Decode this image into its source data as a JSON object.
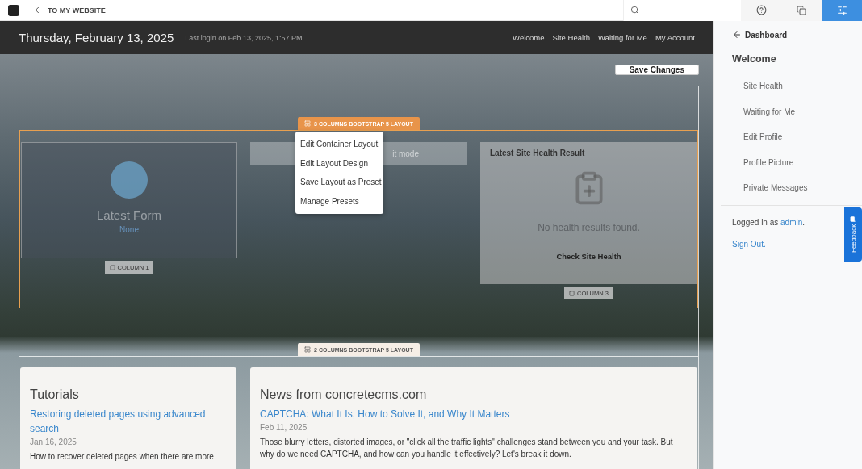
{
  "toolbar": {
    "back_link": "TO MY WEBSITE",
    "buttons": [
      {
        "kind": "help",
        "selected": false
      },
      {
        "kind": "pages",
        "selected": false
      },
      {
        "kind": "settings",
        "selected": true
      }
    ]
  },
  "header": {
    "date": "Thursday, February 13, 2025",
    "last_login": "Last login on Feb 13, 2025, 1:57 PM",
    "nav": [
      "Welcome",
      "Site Health",
      "Waiting for Me",
      "My Account"
    ]
  },
  "save_button": "Save Changes",
  "layout_1": {
    "label": "3 COLUMNS BOOTSTRAP 5 LAYOUT",
    "menu": [
      "Edit Container Layout",
      "Edit Layout Design",
      "Save Layout as Preset",
      "Manage Presets"
    ],
    "columns": [
      {
        "kind": "form",
        "title": "Latest Form",
        "link": "None",
        "tag": "COLUMN 1"
      },
      {
        "kind": "note",
        "text": "it mode"
      },
      {
        "kind": "health",
        "title": "Latest Site Health Result",
        "message": "No health results found.",
        "button": "Check Site Health",
        "tag": "COLUMN 3"
      }
    ]
  },
  "layout_2": {
    "label": "2 COLUMNS BOOTSTRAP 5 LAYOUT",
    "cards": [
      {
        "title": "Tutorials",
        "link": "Restoring deleted pages using advanced search",
        "date": "Jan 16, 2025",
        "text": "How to recover deleted pages when there are more"
      },
      {
        "title": "News from concretecms.com",
        "link": "CAPTCHA: What It Is, How to Solve It, and Why It Matters",
        "date": "Feb 11, 2025",
        "text": "Those blurry letters, distorted images, or \"click all the traffic lights\" challenges stand between you and your task. But why do we need CAPTCHA, and how can you handle it effectively? Let's break it down."
      }
    ]
  },
  "sidebar": {
    "back": "Dashboard",
    "heading": "Welcome",
    "items": [
      "Site Health",
      "Waiting for Me",
      "Edit Profile",
      "Profile Picture",
      "Private Messages"
    ],
    "logged_in": "Logged in as",
    "user": "admin",
    "after_user": ".",
    "sign_out": "Sign Out.",
    "feedback": "Feedback"
  }
}
